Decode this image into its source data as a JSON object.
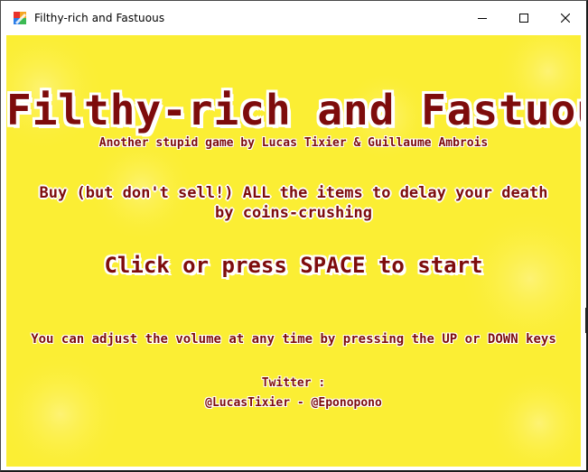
{
  "window": {
    "title": "Filthy-rich and Fastuous",
    "icon": "app-logo-icon",
    "controls": [
      "minimize-icon",
      "maximize-icon",
      "close-icon"
    ]
  },
  "game": {
    "background_color": "#fbee34",
    "text_color": "#7e0c0c",
    "outline_color": "#ffffff",
    "title": "Filthy-rich and Fastuous",
    "subtitle": "Another stupid game by Lucas Tixier & Guillaume Ambrois",
    "instructions_line1": "Buy (but don't sell!) ALL the items to delay your death",
    "instructions_line2": "by coins-crushing",
    "start_prompt": "Click or press SPACE to start",
    "volume_hint": "You can adjust the volume at any time by pressing the UP or DOWN keys",
    "twitter_label": "Twitter :",
    "twitter_handles": "@LucasTixier - @Eponopono"
  }
}
